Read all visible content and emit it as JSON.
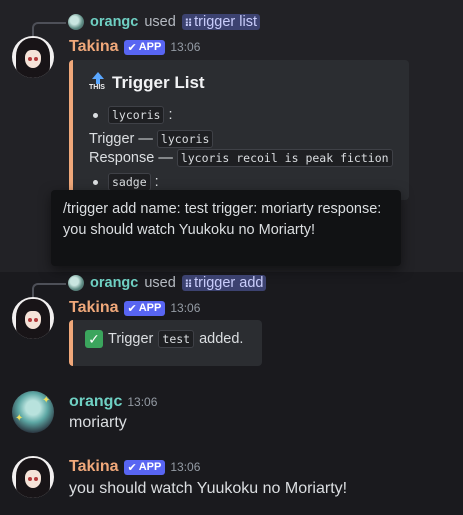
{
  "message1": {
    "reply": {
      "user": "orangc",
      "used": "used",
      "command": "trigger list"
    },
    "author": "Takina",
    "badge": "APP",
    "time": "13:06",
    "embed": {
      "icon_text": "THIS",
      "title": "Trigger List",
      "bullet1": "lycoris",
      "bullet1_suffix": ":",
      "trigger_label": "Trigger —",
      "trigger_value": "lycoris",
      "response_label": "Response —",
      "response_value": "lycoris recoil is peak fiction",
      "bullet2": "sadge",
      "bullet2_suffix": ":"
    }
  },
  "tooltip": {
    "text": "/trigger add name: test trigger: moriarty response: you should watch Yuukoku no Moriarty!"
  },
  "message2": {
    "reply": {
      "user": "orangc",
      "used": "used",
      "command": "trigger add"
    },
    "author": "Takina",
    "badge": "APP",
    "time": "13:06",
    "embed": {
      "prefix": "Trigger",
      "code": "test",
      "suffix": "added."
    }
  },
  "message3": {
    "author": "orangc",
    "time": "13:06",
    "text": "moriarty"
  },
  "message4": {
    "author": "Takina",
    "badge": "APP",
    "time": "13:06",
    "text": "you should watch Yuukoku no Moriarty!"
  },
  "colors": {
    "background": "#1a1a1e",
    "embed": "#2b2d31",
    "accent_orange": "#f0a87a",
    "username_green": "#6fd0c3",
    "app_badge": "#5865f2",
    "command_chip": "#3c4270"
  },
  "icons": {
    "command": "slash-command-icon",
    "verified": "checkmark-icon",
    "this": "this-up-arrow-icon",
    "success": "green-checkmark-icon"
  }
}
